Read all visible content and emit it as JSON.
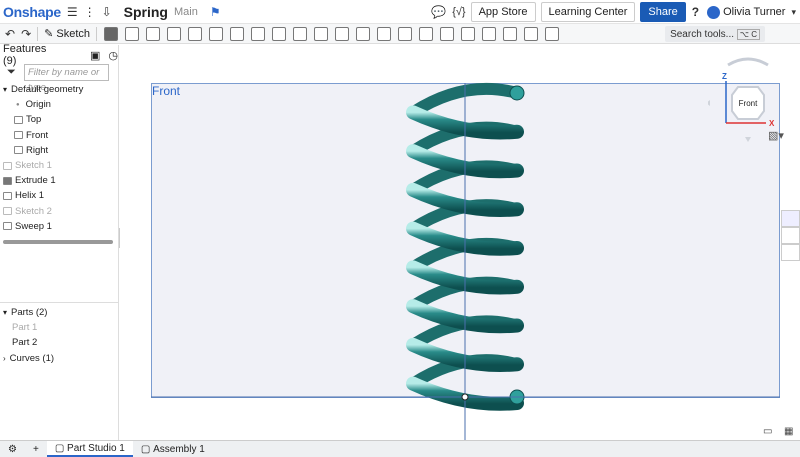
{
  "top": {
    "logo": "Onshape",
    "doc": "Spring",
    "workspace": "Main",
    "app_store": "App Store",
    "learning_center": "Learning Center",
    "share": "Share",
    "help": "?",
    "user": "Olivia Turner"
  },
  "toolbar": {
    "sketch": "Sketch",
    "search": "Search tools...",
    "shortcut": "⌥ C"
  },
  "sidebar": {
    "features_title": "Features (9)",
    "filter_placeholder": "Filter by name or type",
    "tree": [
      "Default geometry",
      "Origin",
      "Top",
      "Front",
      "Right",
      "Sketch 1",
      "Extrude 1",
      "Helix 1",
      "Sketch 2",
      "Sweep 1"
    ],
    "parts_title": "Parts (2)",
    "parts": [
      "Part 1",
      "Part 2"
    ],
    "curves": "Curves (1)"
  },
  "viewport": {
    "plane_label": "Front",
    "cube_face": "Front",
    "axis_z": "Z",
    "axis_x": "X"
  },
  "status": {
    "tab1": "Part Studio 1",
    "tab2": "Assembly 1"
  },
  "colors": {
    "brand": "#2b66c9",
    "share": "#1a5bb5",
    "spring": "#2a8c8a"
  }
}
